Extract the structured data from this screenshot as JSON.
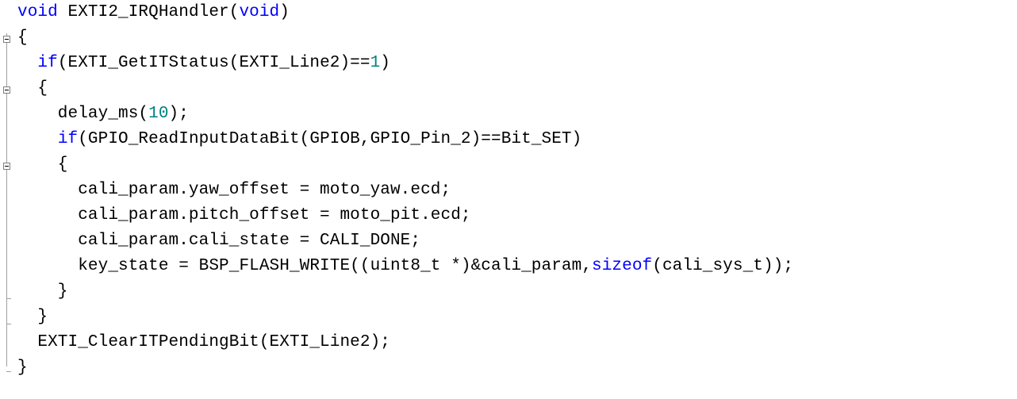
{
  "colors": {
    "keyword": "#0000ff",
    "number": "#008080",
    "text": "#000000",
    "background": "#ffffff",
    "fold_marker": "#808080"
  },
  "icons": {
    "fold": "fold-collapse-icon"
  },
  "code": {
    "l1": {
      "kw1": "void",
      "t1": " EXTI2_IRQHandler(",
      "kw2": "void",
      "t2": ")"
    },
    "l2": {
      "t1": "{"
    },
    "l3": {
      "indent": "  ",
      "kw1": "if",
      "t1": "(EXTI_GetITStatus(EXTI_Line2)==",
      "n1": "1",
      "t2": ")"
    },
    "l4": {
      "t1": "  {"
    },
    "l5": {
      "t1": "    delay_ms(",
      "n1": "10",
      "t2": ");"
    },
    "l6": {
      "indent": "    ",
      "kw1": "if",
      "t1": "(GPIO_ReadInputDataBit(GPIOB,GPIO_Pin_2)==Bit_SET)"
    },
    "l7": {
      "t1": "    {"
    },
    "l8": {
      "t1": "      cali_param.yaw_offset = moto_yaw.ecd;"
    },
    "l9": {
      "t1": "      cali_param.pitch_offset = moto_pit.ecd;"
    },
    "l10": {
      "t1": "      cali_param.cali_state = CALI_DONE;"
    },
    "l11": {
      "t1": "      key_state = BSP_FLASH_WRITE((uint8_t *)&cali_param,",
      "kw1": "sizeof",
      "t2": "(cali_sys_t));"
    },
    "l12": {
      "t1": "    }"
    },
    "l13": {
      "t1": "  }"
    },
    "l14": {
      "t1": "  EXTI_ClearITPendingBit(EXTI_Line2);"
    },
    "l15": {
      "t1": "}"
    }
  }
}
